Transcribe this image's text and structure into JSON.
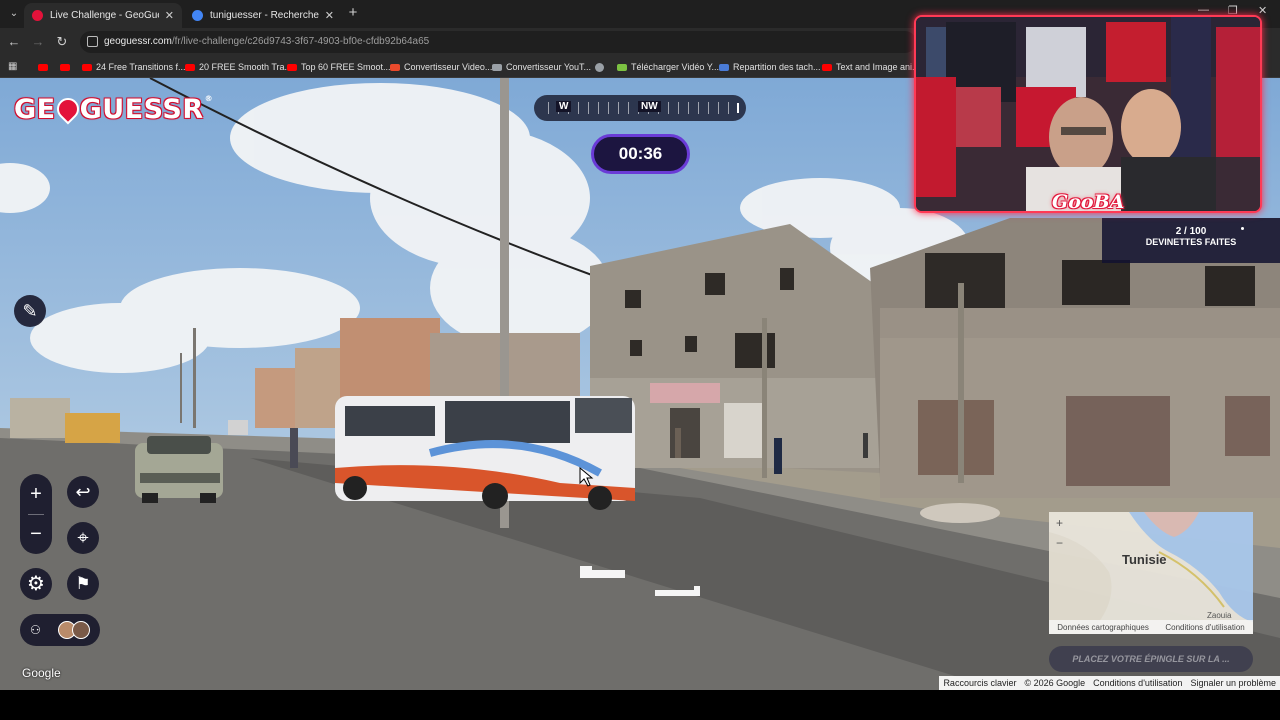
{
  "browser": {
    "tabs": [
      {
        "title": "Live Challenge - GeoGuessr",
        "active": true,
        "favicon_color": "#e3123a"
      },
      {
        "title": "tuniguesser - Recherche Googl",
        "active": false,
        "favicon_color": "#4285f4"
      }
    ],
    "url_host": "geoguessr.com",
    "url_path": "/fr/live-challenge/c26d9743-3f67-4903-bf0e-cfdb92b64a65",
    "bookmarks": [
      {
        "label": "24 Free Transitions f...",
        "color": "#ff0000"
      },
      {
        "label": "20 FREE Smooth Tra...",
        "color": "#ff0000"
      },
      {
        "label": "Top 60 FREE Smoot...",
        "color": "#ff0000"
      },
      {
        "label": "Convertisseur Video...",
        "color": "#e94a2c"
      },
      {
        "label": "Convertisseur YouT...",
        "color": "#9aa0a6"
      },
      {
        "label": "",
        "color": "#9aa0a6"
      },
      {
        "label": "Télécharger Vidéo Y...",
        "color": "#7cc242"
      },
      {
        "label": "Repartition des tach...",
        "color": "#4a7bd6"
      },
      {
        "label": "Text and Image ani...",
        "color": "#ff0000"
      }
    ]
  },
  "game": {
    "logo": "GE",
    "logo_rest": "GUESSR",
    "logo_reg": "®",
    "compass": {
      "w": "W",
      "nw": "NW"
    },
    "timer": "00:36",
    "guesses_count": "2 / 100",
    "guesses_label": "DEVINETTES FAITES",
    "controls": {
      "zoom_in": "+",
      "zoom_out": "−",
      "undo": "↩",
      "pin": "⌖",
      "settings": "⚙",
      "flag": "⚑"
    },
    "google_label": "Google",
    "minimap": {
      "zoom_in": "+",
      "zoom_out": "−",
      "country": "Tunisie",
      "town": "Zaouia",
      "footer_left": "Données cartographiques",
      "footer_right": "Conditions d'utilisation"
    },
    "guess_button": "PLACEZ VOTRE ÉPINGLE SUR LA ...",
    "attribution": [
      "Raccourcis clavier",
      "© 2026 Google",
      "Conditions d'utilisation",
      "Signaler un problème"
    ]
  },
  "webcam": {
    "label": "GooBA"
  }
}
